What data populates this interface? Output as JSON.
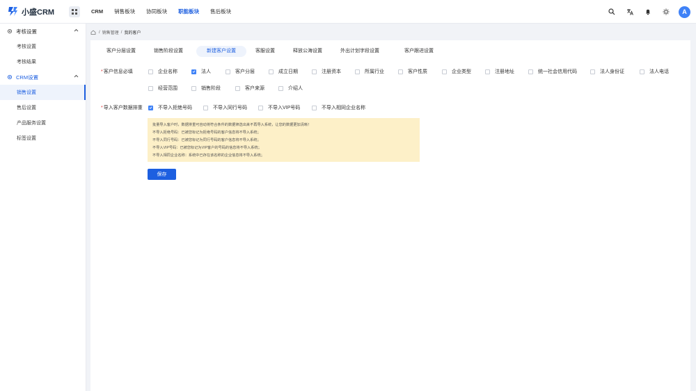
{
  "app": {
    "title": "小盛CRM",
    "brand_color": "#1d5fe0"
  },
  "topnav": {
    "items": [
      {
        "label": "CRM"
      },
      {
        "label": "销售板块"
      },
      {
        "label": "协同板块"
      },
      {
        "label": "职能板块",
        "active": true
      },
      {
        "label": "售后板块"
      }
    ]
  },
  "topbar_icons": [
    "search-icon",
    "translate-icon",
    "bell-icon",
    "theme-icon"
  ],
  "user": {
    "avatar_letter": "A"
  },
  "sidebar": {
    "groups": [
      {
        "label": "考核设置",
        "icon": "gear-icon",
        "items": [
          "考核设置",
          "考核结果"
        ]
      },
      {
        "label": "CRM设置",
        "icon": "gear-icon",
        "active": true,
        "items": [
          "销售设置",
          "售后设置",
          "产品服务设置",
          "标签设置"
        ],
        "active_item": "销售设置"
      }
    ]
  },
  "breadcrumb": {
    "items": [
      "销售管理",
      "我的客户"
    ]
  },
  "tabs": [
    {
      "label": "客户分层设置"
    },
    {
      "label": "销售阶段设置"
    },
    {
      "label": "新建客户设置",
      "active": true
    },
    {
      "label": "客服设置"
    },
    {
      "label": "释放公海设置"
    },
    {
      "label": "外出计划字段设置"
    },
    {
      "label": "客户跟进设置"
    }
  ],
  "form": {
    "required_label": "客户信息必填",
    "required_fields": [
      {
        "label": "企业名称",
        "checked": false
      },
      {
        "label": "法人",
        "checked": true
      },
      {
        "label": "客户分层",
        "checked": false
      },
      {
        "label": "成立日期",
        "checked": false
      },
      {
        "label": "注册资本",
        "checked": false
      },
      {
        "label": "所属行业",
        "checked": false
      },
      {
        "label": "客户性质",
        "checked": false
      },
      {
        "label": "企业类型",
        "checked": false
      },
      {
        "label": "注册地址",
        "checked": false
      },
      {
        "label": "统一社会信用代码",
        "checked": false
      },
      {
        "label": "法人身份证",
        "checked": false
      },
      {
        "label": "法人电话",
        "checked": false
      },
      {
        "label": "经营范围",
        "checked": false
      },
      {
        "label": "销售阶段",
        "checked": false
      },
      {
        "label": "客户来源",
        "checked": false
      },
      {
        "label": "介绍人",
        "checked": false
      }
    ],
    "exclude_label": "导入客户数据排重",
    "exclude_options": [
      {
        "label": "不导入拒绝号码",
        "checked": true
      },
      {
        "label": "不导入同行号码",
        "checked": false
      },
      {
        "label": "不导入VIP号码",
        "checked": false
      },
      {
        "label": "不导入相同企业名称",
        "checked": false
      }
    ],
    "notice_lines": [
      "批量导入客户时，数据排重可自动将符合条件的数据筛选出来不再导入系统，让您的数据更加清晰！",
      "不导入拒绝号码：已被您标记为拒绝号码的客户信息将不导入系统；",
      "不导入同行号码：已被您标记为同行号码的客户信息将不导入系统；",
      "不导入VIP号码：已被您标记为VIP客户的号码的信息将不导入系统；",
      "不导入相同企业名称：系统中已存在该名称的企业信息将不导入系统；"
    ],
    "save_label": "保存"
  }
}
